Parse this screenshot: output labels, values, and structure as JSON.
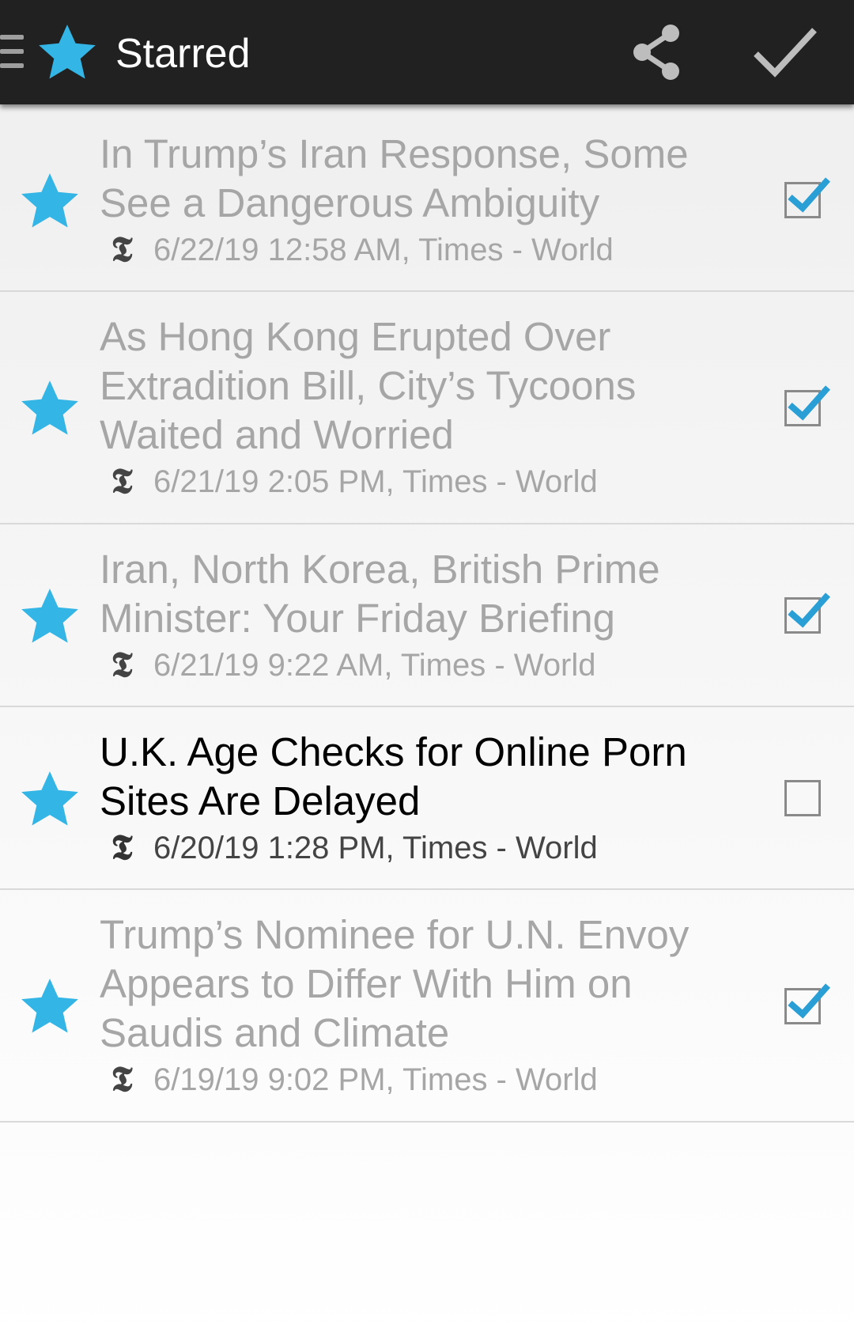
{
  "appbar": {
    "title": "Starred",
    "menu_icon": "hamburger-icon",
    "app_icon": "star-icon",
    "actions": [
      {
        "name": "share",
        "icon": "share-icon"
      },
      {
        "name": "done",
        "icon": "check-icon"
      }
    ]
  },
  "colors": {
    "appbar_bg": "#212121",
    "accent_star": "#33b5e5",
    "read_text": "#a6a6a6",
    "unread_text": "#000000"
  },
  "articles": [
    {
      "title": "In Trump’s Iran Response, Some See a Dangerous Ambiguity",
      "meta": "6/22/19 12:58 AM, Times - World",
      "source_icon": "nyt-logo-icon",
      "starred": true,
      "checked": true
    },
    {
      "title": "As Hong Kong Erupted Over Extradition Bill, City’s Tycoons Waited and Worried",
      "meta": "6/21/19 2:05 PM, Times - World",
      "source_icon": "nyt-logo-icon",
      "starred": true,
      "checked": true
    },
    {
      "title": "Iran, North Korea, British Prime Minister: Your Friday Briefing",
      "meta": "6/21/19 9:22 AM, Times - World",
      "source_icon": "nyt-logo-icon",
      "starred": true,
      "checked": true
    },
    {
      "title": "U.K. Age Checks for Online Porn Sites Are Delayed",
      "meta": "6/20/19 1:28 PM, Times - World",
      "source_icon": "nyt-logo-icon",
      "starred": true,
      "checked": false
    },
    {
      "title": "Trump’s Nominee for U.N. Envoy Appears to Differ With Him on Saudis and Climate",
      "meta": "6/19/19 9:02 PM, Times - World",
      "source_icon": "nyt-logo-icon",
      "starred": true,
      "checked": true
    }
  ]
}
